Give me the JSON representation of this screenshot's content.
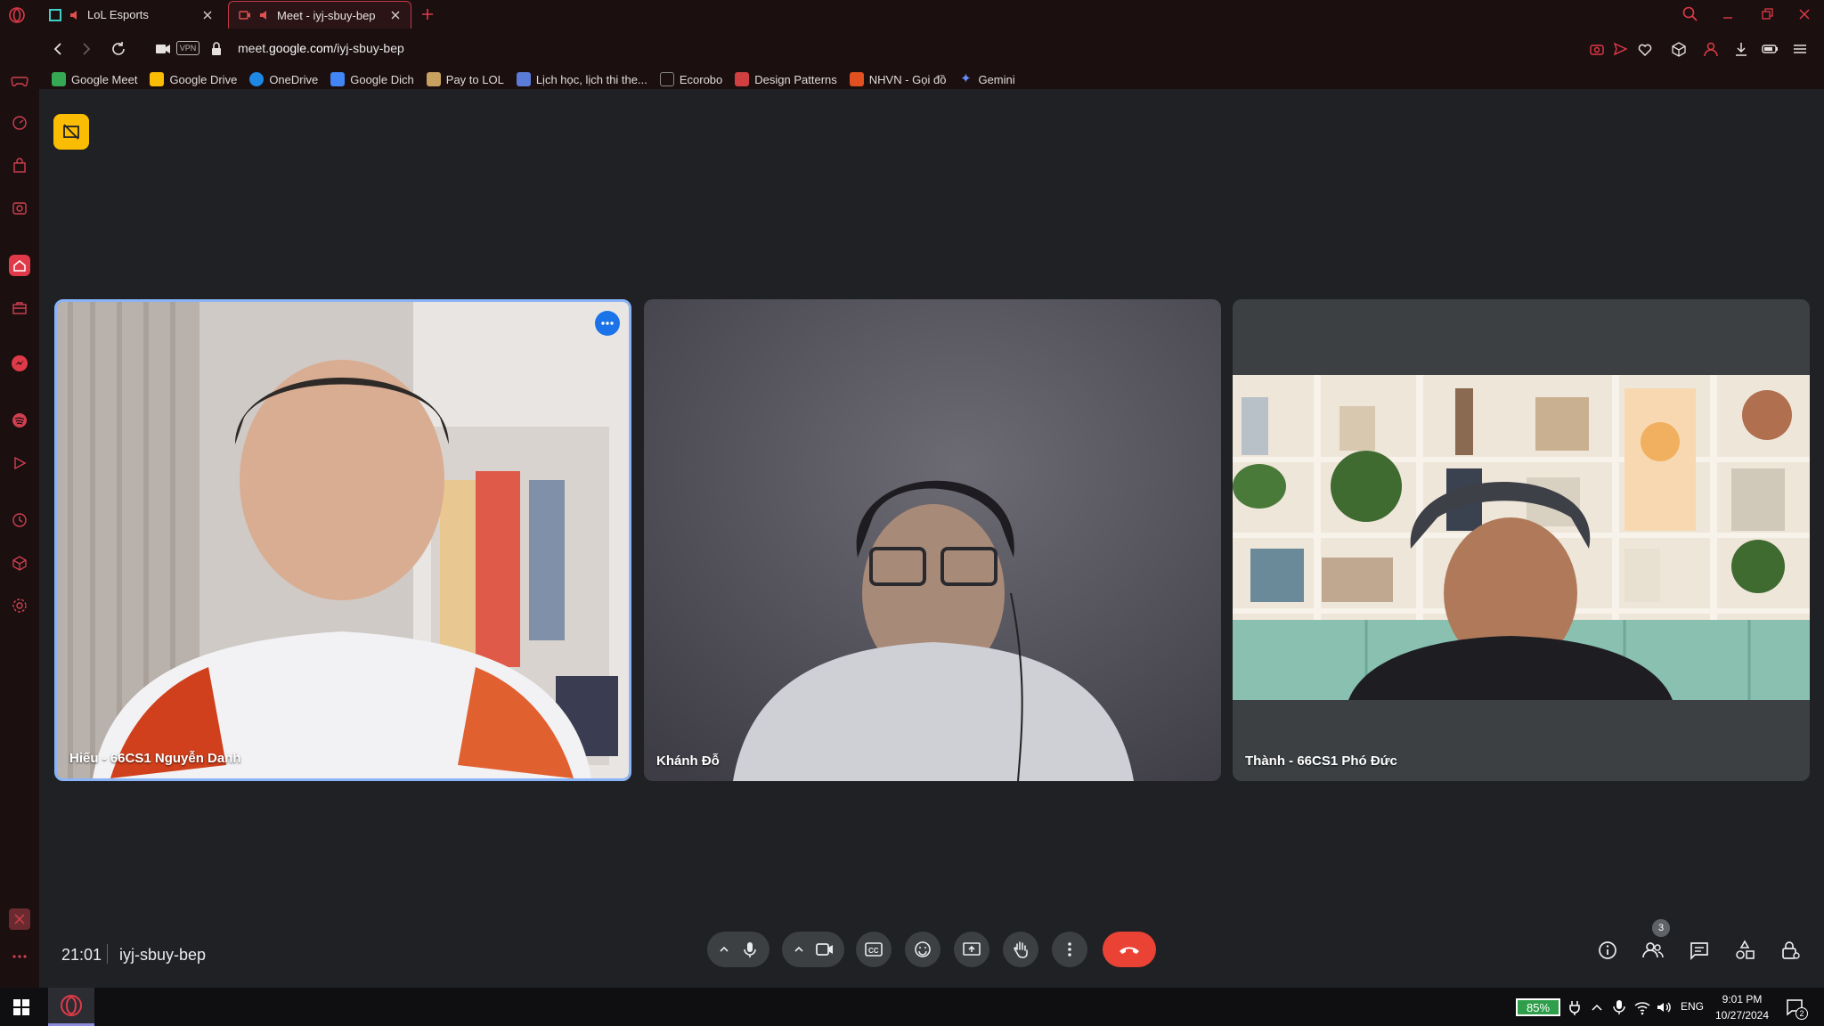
{
  "browser": {
    "tabs": [
      {
        "title": "LoL Esports"
      },
      {
        "title": "Meet - iyj-sbuy-bep",
        "active": true
      }
    ],
    "url": {
      "prefix": "meet.",
      "domain": "google.com",
      "path": "/iyj-sbuy-bep"
    },
    "vpn_badge": "VPN",
    "bookmarks": [
      {
        "label": "Google Meet",
        "color": "#34a853"
      },
      {
        "label": "Google Drive",
        "color": "#fbbc04"
      },
      {
        "label": "OneDrive",
        "color": "#1e88e5"
      },
      {
        "label": "Google Dich",
        "color": "#4285f4"
      },
      {
        "label": "Pay to LOL",
        "color": "#c8a060"
      },
      {
        "label": "Lịch học, lịch thi the...",
        "color": "#5a7bd8"
      },
      {
        "label": "Ecorobo",
        "color": "#888888"
      },
      {
        "label": "Design Patterns",
        "color": "#d04040"
      },
      {
        "label": "NHVN - Gọi đồ",
        "color": "#e05020"
      },
      {
        "label": "Gemini",
        "color": "#6a8cff"
      }
    ]
  },
  "meet": {
    "participants": [
      {
        "name": "Hiếu - 66CS1 Nguyễn Danh",
        "active_speaker": true
      },
      {
        "name": "Khánh Đỗ"
      },
      {
        "name": "Thành - 66CS1 Phó Đức"
      }
    ],
    "time": "21:01",
    "meeting_code": "iyj-sbuy-bep",
    "people_count": "3",
    "colors": {
      "end_call": "#ea4335",
      "active_border": "#8ab4f8",
      "record_badge": "#fbbc04"
    }
  },
  "taskbar": {
    "battery": "85%",
    "language": "ENG",
    "time": "9:01 PM",
    "date": "10/27/2024",
    "notifications": "2"
  }
}
